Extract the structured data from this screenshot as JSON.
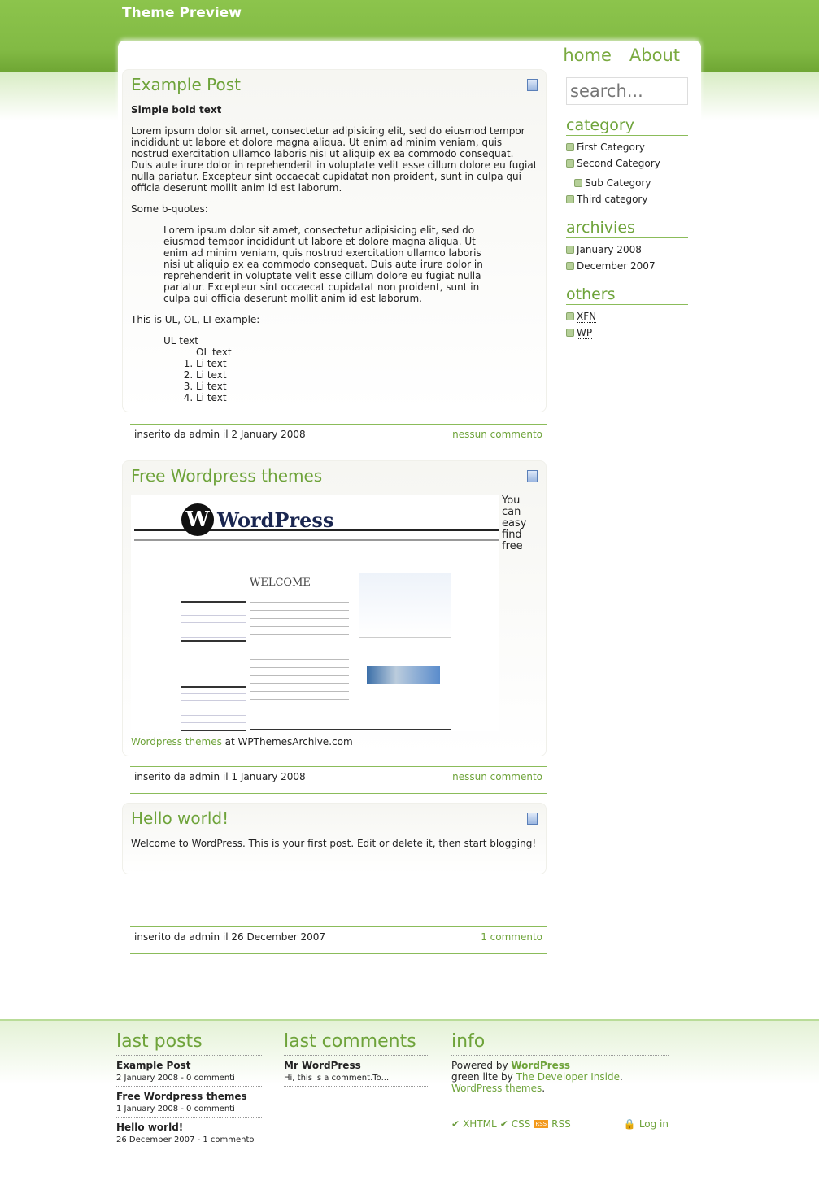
{
  "site_title": "Theme Preview",
  "nav": [
    "home",
    "About"
  ],
  "search_placeholder": "search...",
  "posts": [
    {
      "title": "Example Post",
      "bold": "Simple bold text",
      "p1": "Lorem ipsum dolor sit amet, consectetur adipisicing elit, sed do eiusmod tempor incididunt ut labore et dolore magna aliqua. Ut enim ad minim veniam, quis nostrud exercitation ullamco laboris nisi ut aliquip ex ea commodo consequat. Duis aute irure dolor in reprehenderit in voluptate velit esse cillum dolore eu fugiat nulla pariatur. Excepteur sint occaecat cupidatat non proident, sunt in culpa qui officia deserunt mollit anim id est laborum.",
      "bq_label": "Some b-quotes:",
      "bq": "Lorem ipsum dolor sit amet, consectetur adipisicing elit, sed do eiusmod tempor incididunt ut labore et dolore magna aliqua. Ut enim ad minim veniam, quis nostrud exercitation ullamco laboris nisi ut aliquip ex ea commodo consequat. Duis aute irure dolor in reprehenderit in voluptate velit esse cillum dolore eu fugiat nulla pariatur. Excepteur sint occaecat cupidatat non proident, sunt in culpa qui officia deserunt mollit anim id est laborum.",
      "list_label": "This is UL, OL, LI example:",
      "ul": "UL text",
      "ol": "OL text",
      "li": [
        "Li text",
        "Li text",
        "Li text",
        "Li text"
      ],
      "meta": "inserito da admin il 2 January 2008",
      "comments": "nessun commento"
    },
    {
      "title": "Free Wordpress themes",
      "side_text": "You can easy find free",
      "link": "Wordpress themes",
      "after_link": " at WPThemesArchive.com",
      "image_logo": "WordPress",
      "meta": "inserito da admin il 1 January 2008",
      "comments": "nessun commento"
    },
    {
      "title": "Hello world!",
      "p1": "Welcome to WordPress. This is your first post. Edit or delete it, then start blogging!",
      "meta": "inserito da admin il 26 December 2007",
      "comments": "1 commento"
    }
  ],
  "sidebar": {
    "category": {
      "title": "category",
      "items": [
        "First Category",
        "Second Category",
        "Sub Category",
        "Third category"
      ]
    },
    "archives": {
      "title": "archivies",
      "items": [
        "January 2008",
        "December 2007"
      ]
    },
    "others": {
      "title": "others",
      "items": [
        "XFN",
        "WP"
      ]
    }
  },
  "footer": {
    "last_posts": {
      "title": "last posts",
      "items": [
        {
          "t": "Example Post",
          "m": "2 January 2008 - 0 commenti"
        },
        {
          "t": "Free Wordpress themes",
          "m": "1 January 2008 - 0 commenti"
        },
        {
          "t": "Hello world!",
          "m": "26 December 2007 - 1 commento"
        }
      ]
    },
    "last_comments": {
      "title": "last comments",
      "items": [
        {
          "t": "Mr WordPress",
          "m": "Hi, this is a comment.To..."
        }
      ]
    },
    "info": {
      "title": "info",
      "powered": "Powered by ",
      "wp": "WordPress",
      "green": "green lite by ",
      "dev": "The Developer Inside",
      "dot": ".",
      "themes": "WordPress themes",
      "xhtml": "XHTML",
      "css": "CSS",
      "rss": "RSS",
      "rss_badge": "RSS",
      "login": "Log in"
    }
  },
  "colors": {
    "accent": "#6ea33a",
    "header": "#86be48"
  }
}
